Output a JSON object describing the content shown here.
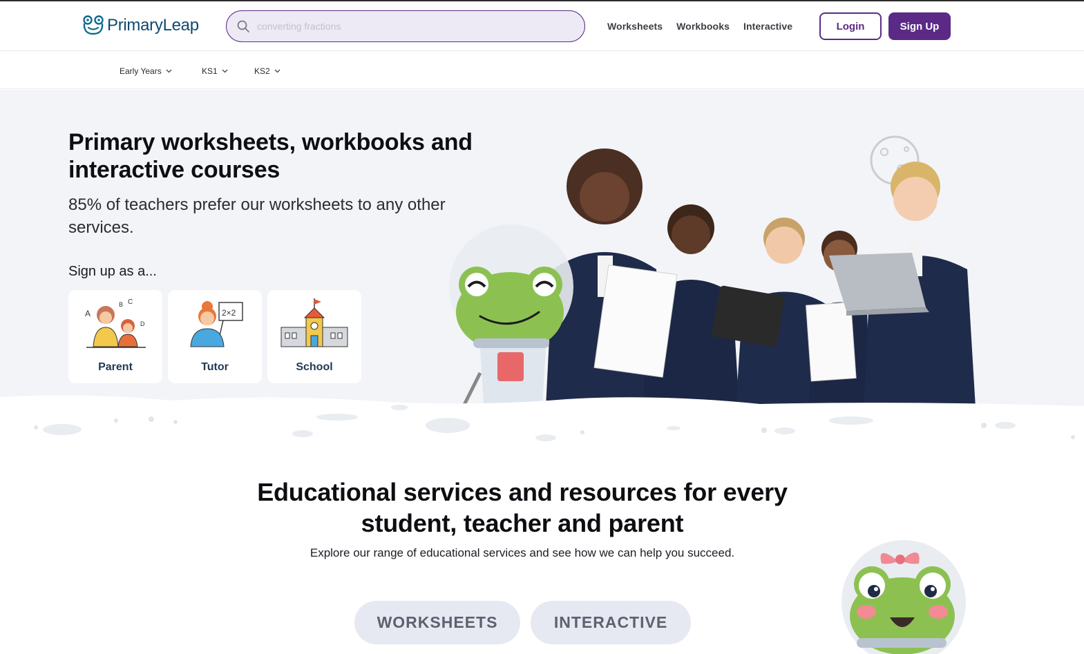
{
  "header": {
    "logo_text": "PrimaryLeap",
    "search_placeholder": "converting fractions",
    "nav": [
      "Worksheets",
      "Workbooks",
      "Interactive"
    ],
    "login_label": "Login",
    "signup_label": "Sign Up"
  },
  "subnav": [
    "Early Years",
    "KS1",
    "KS2"
  ],
  "hero": {
    "title": "Primary worksheets, workbooks and interactive courses",
    "subtitle": "85% of teachers prefer our worksheets to any other services.",
    "signup_prompt": "Sign up as a...",
    "cards": [
      "Parent",
      "Tutor",
      "School"
    ]
  },
  "services": {
    "title": "Educational services and resources for every student, teacher and parent",
    "subtitle": "Explore our range of educational services and see how we can help you succeed.",
    "buttons": [
      "WORKSHEETS",
      "INTERACTIVE"
    ]
  },
  "colors": {
    "brand_purple": "#5b2a86",
    "logo_blue": "#0f4a6e",
    "hero_bg": "#f2f4f7",
    "frog_green": "#8cc152"
  }
}
